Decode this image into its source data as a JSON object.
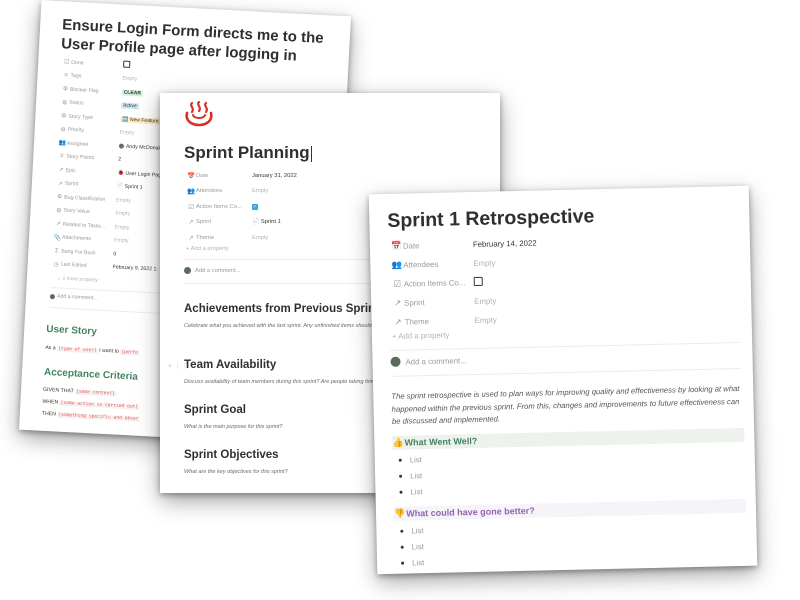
{
  "card1": {
    "title": "Ensure Login Form directs me to the User Profile page after logging in",
    "properties": [
      {
        "icon": "checkbox-icon",
        "glyph": "☑",
        "name": "Done",
        "value": "",
        "type": "checkbox"
      },
      {
        "icon": "list-icon",
        "glyph": "≡",
        "name": "Tags",
        "value": "Empty",
        "type": "empty"
      },
      {
        "icon": "gear-icon",
        "glyph": "⚙",
        "name": "Blocker Flag",
        "value": "CLEAR",
        "type": "tag-clear"
      },
      {
        "icon": "gear-icon",
        "glyph": "⚙",
        "name": "Status",
        "value": "Active",
        "type": "tag-active"
      },
      {
        "icon": "gear-icon",
        "glyph": "⚙",
        "name": "Story Type",
        "value": "🆕 New Feature",
        "type": "tag-feature"
      },
      {
        "icon": "gear-icon",
        "glyph": "⚙",
        "name": "Priority",
        "value": "Empty",
        "type": "empty"
      },
      {
        "icon": "people-icon",
        "glyph": "👥",
        "name": "Assignee",
        "value": "Andy McDonald",
        "type": "person"
      },
      {
        "icon": "hash-icon",
        "glyph": "#",
        "name": "Story Points",
        "value": "2",
        "type": "text"
      },
      {
        "icon": "arrow-icon",
        "glyph": "↗",
        "name": "Epic",
        "value": "🐞 User Login Page",
        "type": "text"
      },
      {
        "icon": "arrow-icon",
        "glyph": "↗",
        "name": "Sprint",
        "value": "📄 Sprint 1",
        "type": "text"
      },
      {
        "icon": "gear-icon",
        "glyph": "⚙",
        "name": "Bug Classification",
        "value": "Empty",
        "type": "empty"
      },
      {
        "icon": "gear-icon",
        "glyph": "⚙",
        "name": "Story Value",
        "value": "Empty",
        "type": "empty"
      },
      {
        "icon": "arrow-icon",
        "glyph": "↗",
        "name": "Related to Tasks...",
        "value": "Empty",
        "type": "empty"
      },
      {
        "icon": "paperclip-icon",
        "glyph": "📎",
        "name": "Attachments",
        "value": "Empty",
        "type": "empty"
      },
      {
        "icon": "sigma-icon",
        "glyph": "Σ",
        "name": "Bang For Buck",
        "value": "0",
        "type": "text"
      },
      {
        "icon": "clock-icon",
        "glyph": "◷",
        "name": "Last Edited",
        "value": "February 9, 2022 1:",
        "type": "text"
      }
    ],
    "more_property": "1 more property",
    "comment_placeholder": "Add a comment...",
    "user_story_heading": "User Story",
    "user_story_pre": "As a",
    "user_story_code1": "[type of user]",
    "user_story_mid": "I want to",
    "user_story_code2": "[perfo",
    "acceptance_heading": "Acceptance Criteria",
    "given_label": "GIVEN THAT",
    "given_code": "[some context]",
    "when_label": "WHEN",
    "when_code": "[some action is carried out]",
    "then_label": "THEN",
    "then_code": "[something specific and obser"
  },
  "card2": {
    "title": "Sprint Planning",
    "properties": [
      {
        "icon": "calendar-icon",
        "glyph": "📅",
        "name": "Date",
        "value": "January 31, 2022",
        "type": "text"
      },
      {
        "icon": "people-icon",
        "glyph": "👥",
        "name": "Attendees",
        "value": "Empty",
        "type": "empty"
      },
      {
        "icon": "checkbox-icon",
        "glyph": "☑",
        "name": "Action Items Co...",
        "value": "✓",
        "type": "bluecheck"
      },
      {
        "icon": "arrow-icon",
        "glyph": "↗",
        "name": "Sprint",
        "value": "📄 Sprint 1",
        "type": "text"
      },
      {
        "icon": "arrow-icon",
        "glyph": "↗",
        "name": "Theme",
        "value": "Empty",
        "type": "empty"
      }
    ],
    "add_property": "+ Add a property",
    "comment_placeholder": "Add a comment...",
    "sections": [
      {
        "heading": "Achievements from Previous Sprint",
        "text": "Celebrate what you achieved with the last sprint. Any unfinished items should be reviewed and discussed."
      },
      {
        "heading": "Team Availability",
        "text": "Discuss availability of team members during this sprint? Are people taking time off?"
      },
      {
        "heading": "Sprint Goal",
        "text": "What is the main purpose for this sprint?"
      },
      {
        "heading": "Sprint Objectives",
        "text": "What are the key objectives for this sprint?"
      }
    ]
  },
  "card3": {
    "title": "Sprint 1 Retrospective",
    "properties": [
      {
        "icon": "calendar-icon",
        "glyph": "📅",
        "name": "Date",
        "value": "February 14, 2022",
        "type": "text"
      },
      {
        "icon": "people-icon",
        "glyph": "👥",
        "name": "Attendees",
        "value": "Empty",
        "type": "empty"
      },
      {
        "icon": "checkbox-icon",
        "glyph": "☑",
        "name": "Action Items Co...",
        "value": "",
        "type": "checkbox"
      },
      {
        "icon": "arrow-icon",
        "glyph": "↗",
        "name": "Sprint",
        "value": "Empty",
        "type": "empty"
      },
      {
        "icon": "arrow-icon",
        "glyph": "↗",
        "name": "Theme",
        "value": "Empty",
        "type": "empty"
      }
    ],
    "add_property": "+ Add a property",
    "comment_placeholder": "Add a comment...",
    "description": "The sprint retrospective is used to plan ways for improving quality and effectiveness by looking at what happened within the previous sprint. From this, changes and improvements to future effectiveness can be discussed and implemented.",
    "went_well_heading": "What Went Well?",
    "went_well_items": [
      "List",
      "List",
      "List"
    ],
    "better_heading": "What could have gone better?",
    "better_items": [
      "List",
      "List",
      "List"
    ]
  },
  "colors": {
    "green_heading": "#448361",
    "purple_heading": "#9065b0",
    "checkbox_blue": "#2eaadc",
    "code_red": "#eb5757"
  }
}
